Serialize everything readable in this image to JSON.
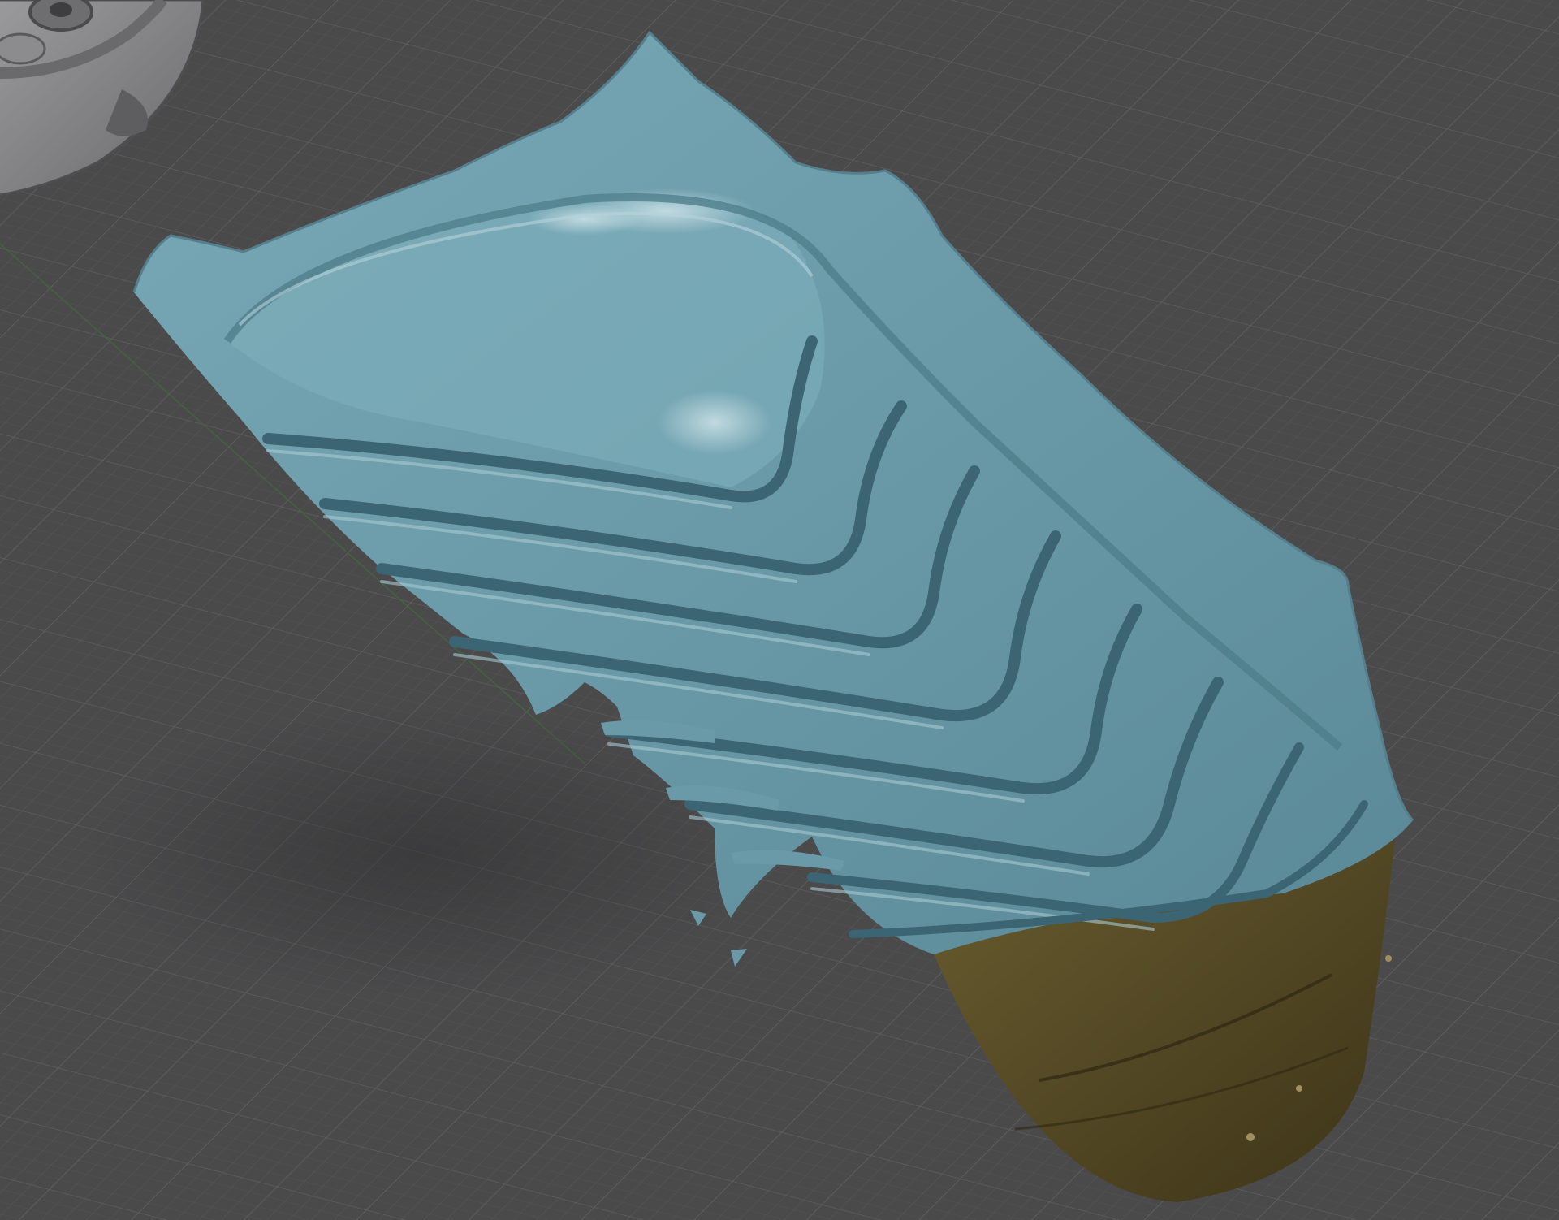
{
  "app": {
    "view": "3d-viewport",
    "projection": "perspective"
  },
  "scene": {
    "ground_grid": {
      "visible": true,
      "line_color": "#5c5c5e",
      "major_line_color": "#646466",
      "background": "#4a4a4b",
      "axis_color": "#3f6a3a"
    },
    "objects": [
      {
        "name": "scanned-mesh-teal",
        "kind": "mesh",
        "color": "#6a9aa8",
        "shade_color": "#3f6a78",
        "highlight_color": "#b9d6de"
      },
      {
        "name": "scanned-mesh-backface",
        "kind": "mesh-interior",
        "color": "#5a4f2a",
        "shade_color": "#3a3318"
      },
      {
        "name": "mechanical-part-grey",
        "kind": "solid",
        "color": "#8a8a8c",
        "shade_color": "#5e5e60"
      }
    ]
  }
}
